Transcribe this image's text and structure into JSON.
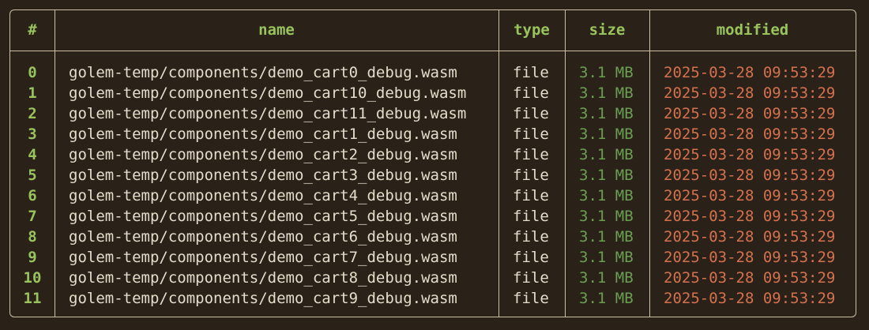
{
  "headers": {
    "index": "#",
    "name": "name",
    "type": "type",
    "size": "size",
    "modified": "modified"
  },
  "colors": {
    "background": "#2a2119",
    "border": "#cdbfa6",
    "header_text": "#98c35d",
    "name_text": "#e6dccb",
    "size_text": "#6a9f52",
    "modified_text": "#d5714e"
  },
  "rows": [
    {
      "index": "0",
      "name": "golem-temp/components/demo_cart0_debug.wasm",
      "type": "file",
      "size": "3.1 MB",
      "modified": "2025-03-28 09:53:29"
    },
    {
      "index": "1",
      "name": "golem-temp/components/demo_cart10_debug.wasm",
      "type": "file",
      "size": "3.1 MB",
      "modified": "2025-03-28 09:53:29"
    },
    {
      "index": "2",
      "name": "golem-temp/components/demo_cart11_debug.wasm",
      "type": "file",
      "size": "3.1 MB",
      "modified": "2025-03-28 09:53:29"
    },
    {
      "index": "3",
      "name": "golem-temp/components/demo_cart1_debug.wasm",
      "type": "file",
      "size": "3.1 MB",
      "modified": "2025-03-28 09:53:29"
    },
    {
      "index": "4",
      "name": "golem-temp/components/demo_cart2_debug.wasm",
      "type": "file",
      "size": "3.1 MB",
      "modified": "2025-03-28 09:53:29"
    },
    {
      "index": "5",
      "name": "golem-temp/components/demo_cart3_debug.wasm",
      "type": "file",
      "size": "3.1 MB",
      "modified": "2025-03-28 09:53:29"
    },
    {
      "index": "6",
      "name": "golem-temp/components/demo_cart4_debug.wasm",
      "type": "file",
      "size": "3.1 MB",
      "modified": "2025-03-28 09:53:29"
    },
    {
      "index": "7",
      "name": "golem-temp/components/demo_cart5_debug.wasm",
      "type": "file",
      "size": "3.1 MB",
      "modified": "2025-03-28 09:53:29"
    },
    {
      "index": "8",
      "name": "golem-temp/components/demo_cart6_debug.wasm",
      "type": "file",
      "size": "3.1 MB",
      "modified": "2025-03-28 09:53:29"
    },
    {
      "index": "9",
      "name": "golem-temp/components/demo_cart7_debug.wasm",
      "type": "file",
      "size": "3.1 MB",
      "modified": "2025-03-28 09:53:29"
    },
    {
      "index": "10",
      "name": "golem-temp/components/demo_cart8_debug.wasm",
      "type": "file",
      "size": "3.1 MB",
      "modified": "2025-03-28 09:53:29"
    },
    {
      "index": "11",
      "name": "golem-temp/components/demo_cart9_debug.wasm",
      "type": "file",
      "size": "3.1 MB",
      "modified": "2025-03-28 09:53:29"
    }
  ]
}
